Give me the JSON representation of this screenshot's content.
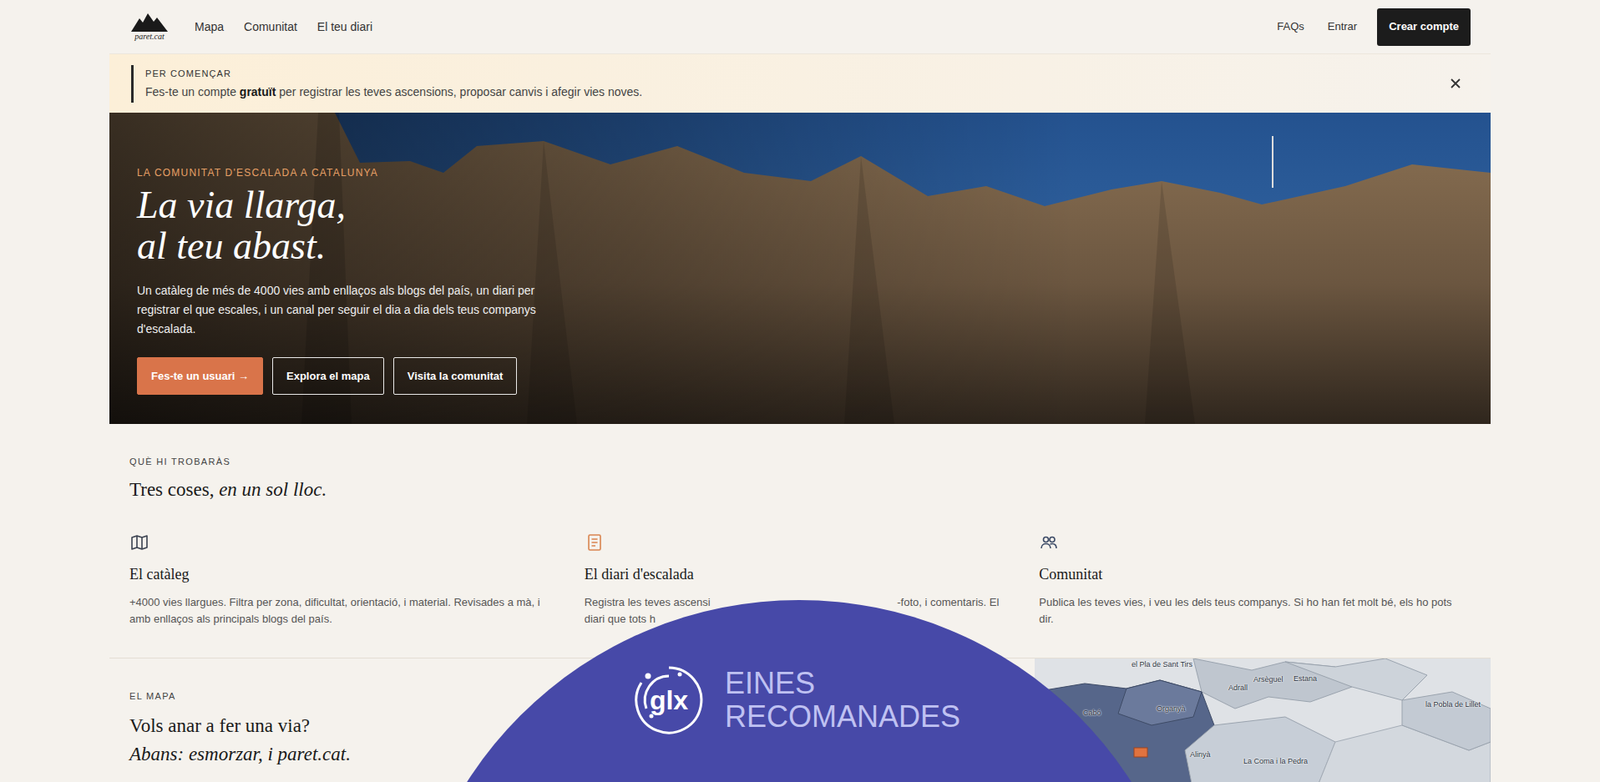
{
  "header": {
    "logo": "paret.cat",
    "nav": [
      "Mapa",
      "Comunitat",
      "El teu diari"
    ],
    "faq": "FAQs",
    "login": "Entrar",
    "signup": "Crear compte"
  },
  "banner": {
    "eyebrow": "PER COMENÇAR",
    "before": "Fes-te un compte ",
    "bold": "gratuït",
    "after": " per registrar les teves ascensions, proposar canvis i afegir vies noves."
  },
  "hero": {
    "eyebrow": "LA COMUNITAT D'ESCALADA A CATALUNYA",
    "title": [
      "La via llarga,",
      "al teu abast."
    ],
    "text": "Un catàleg de més de 4000 vies amb enllaços als blogs del país, un diari per registrar el que escales, i un canal per seguir el dia a dia dels teus companys d'escalada.",
    "buttons": [
      {
        "label": "Fes-te un usuari →",
        "kind": "primary"
      },
      {
        "label": "Explora el mapa",
        "kind": "outline"
      },
      {
        "label": "Visita la comunitat",
        "kind": "outline"
      }
    ]
  },
  "features": {
    "eyebrow": "QUÈ HI TROBARÀS",
    "title": "Tres coses, ",
    "title_italic": "en un sol lloc.",
    "items": [
      {
        "title": "El catàleg",
        "kind": "plain",
        "description": [
          "+4000 vies llargues. Filtra per zona, dificultat, orientació, i material. Revisades a mà, i amb enllaços als principals blogs del país."
        ]
      },
      {
        "title": "El diari d'escalada",
        "kind": "covered",
        "description": [
          "Registra les teves ascensi",
          "-foto, i comentaris. El",
          "diari que tots h"
        ]
      },
      {
        "title": "Comunitat",
        "kind": "plain",
        "description": [
          "Publica les teves vies, i veu les dels teus companys. Si ho han fet molt bé, els ho pots dir."
        ]
      }
    ]
  },
  "map": {
    "eyebrow": "EL MAPA",
    "title": "Vols anar a fer una via?",
    "subtitle": "Abans: esmorzar, i paret.cat.",
    "labels": [
      "el Pla de Sant Tirs",
      "Adrall",
      "Arsèguel",
      "Estana",
      "Cabó",
      "Organyà",
      "Alinyà",
      "la Pobla de Lillet",
      "La Coma i la Pedra"
    ]
  },
  "overlay": {
    "logo": "glx",
    "lines": [
      "EINES",
      "RECOMANADES"
    ]
  }
}
